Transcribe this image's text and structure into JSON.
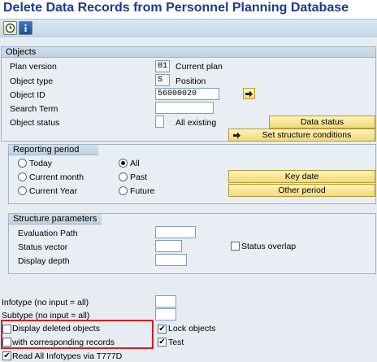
{
  "window": {
    "title": "Delete Data Records from Personnel Planning Database"
  },
  "toolbar": {
    "icons": [
      "clock-execute-icon",
      "info-icon"
    ]
  },
  "objects": {
    "group_title": "Objects",
    "plan_version": {
      "label": "Plan version",
      "value": "01",
      "text": "Current plan"
    },
    "object_type": {
      "label": "Object type",
      "value": "S",
      "text": "Position"
    },
    "object_id": {
      "label": "Object ID",
      "value": "56000020"
    },
    "search_term": {
      "label": "Search Term",
      "value": ""
    },
    "object_status": {
      "label": "Object status",
      "value": "",
      "text": "All existing"
    },
    "data_status_button": "Data status",
    "structure_button": "Set structure conditions"
  },
  "reporting_period": {
    "group_title": "Reporting period",
    "options": {
      "today": "Today",
      "all": "All",
      "current_month": "Current month",
      "past": "Past",
      "current_year": "Current Year",
      "future": "Future"
    },
    "selected": "All",
    "key_date_button": "Key date",
    "other_period_button": "Other period"
  },
  "structure_parameters": {
    "group_title": "Structure parameters",
    "evaluation_path": {
      "label": "Evaluation Path",
      "value": ""
    },
    "status_vector": {
      "label": "Status vector",
      "value": ""
    },
    "display_depth": {
      "label": "Display depth",
      "value": ""
    },
    "status_overlap": {
      "label": "Status overlap",
      "checked": false
    }
  },
  "bottom": {
    "infotype": {
      "label": "Infotype (no input = all)",
      "value": ""
    },
    "subtype": {
      "label": "Subtype (no input = all)",
      "value": ""
    },
    "display_deleted": {
      "label": "Display deleted objects",
      "checked": false
    },
    "with_corresponding": {
      "label": "with corresponding records",
      "checked": false
    },
    "lock_objects": {
      "label": "Lock objects",
      "checked": true
    },
    "test": {
      "label": "Test",
      "checked": true
    },
    "read_all": {
      "label": "Read All Infotypes via T777D",
      "checked": true
    }
  },
  "colors": {
    "title": "#1b3a8a",
    "highlight": "#d21f1f",
    "button": "#f0d978"
  }
}
